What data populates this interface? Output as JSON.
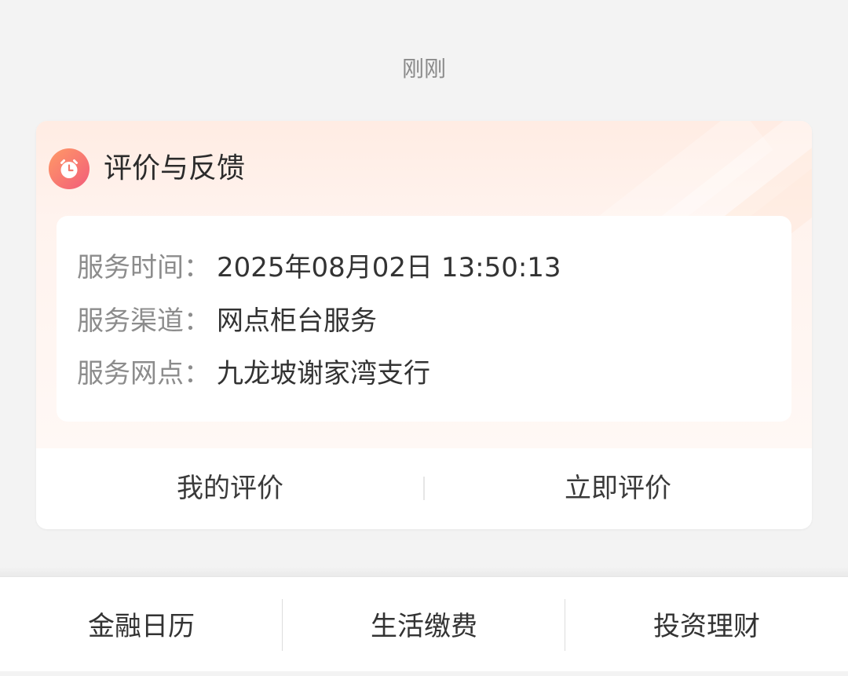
{
  "message": {
    "timestamp": "刚刚"
  },
  "card": {
    "icon": "alarm-clock-icon",
    "title": "评价与反馈",
    "details": [
      {
        "label": "服务时间：",
        "value": "2025年08月02日 13:50:13"
      },
      {
        "label": "服务渠道：",
        "value": "网点柜台服务"
      },
      {
        "label": "服务网点：",
        "value": "九龙坡谢家湾支行"
      }
    ],
    "actions": {
      "my_review": "我的评价",
      "review_now": "立即评价"
    }
  },
  "bottom_menu": {
    "items": [
      {
        "label": "金融日历"
      },
      {
        "label": "生活缴费"
      },
      {
        "label": "投资理财"
      }
    ]
  },
  "colors": {
    "icon_gradient_start": "#ff9a66",
    "icon_gradient_end": "#f25c7a",
    "card_header_tint": "#ffece3",
    "page_background": "#f3f3f3"
  }
}
